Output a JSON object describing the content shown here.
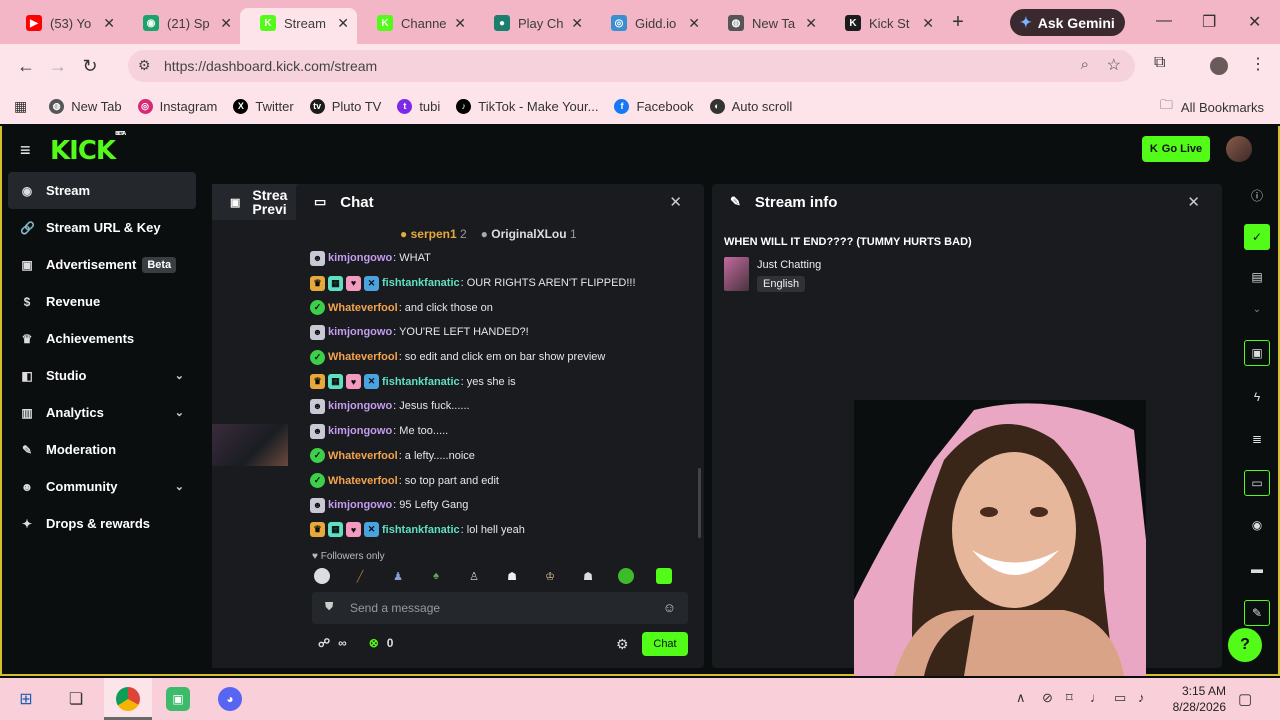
{
  "browser": {
    "tabs": [
      {
        "title": "(53) Yo",
        "favicon_color": "#ff0000",
        "favicon_glyph": "▶",
        "active": false
      },
      {
        "title": "(21) Sp",
        "favicon_color": "#1aa36a",
        "favicon_glyph": "◉",
        "active": false
      },
      {
        "title": "Stream",
        "favicon_color": "#53fc18",
        "favicon_glyph": "K",
        "active": true
      },
      {
        "title": "Channe",
        "favicon_color": "#53fc18",
        "favicon_glyph": "K",
        "active": false
      },
      {
        "title": "Play Ch",
        "favicon_color": "#1a7f6e",
        "favicon_glyph": "●",
        "active": false
      },
      {
        "title": "Gidd.io",
        "favicon_color": "#3a8fd0",
        "favicon_glyph": "◎",
        "active": false
      },
      {
        "title": "New Ta",
        "favicon_color": "#555555",
        "favicon_glyph": "◍",
        "active": false
      },
      {
        "title": "Kick St",
        "favicon_color": "#1c1c1c",
        "favicon_glyph": "K",
        "active": false
      }
    ],
    "gemini_label": "Ask Gemini",
    "url": "https://dashboard.kick.com/stream",
    "bookmarks": [
      {
        "label": "New Tab",
        "color": "#555555",
        "glyph": "◍"
      },
      {
        "label": "Instagram",
        "color": "#d62976",
        "glyph": "◎"
      },
      {
        "label": "Twitter",
        "color": "#000000",
        "glyph": "X"
      },
      {
        "label": "Pluto TV",
        "color": "#1c1c1c",
        "glyph": "tv"
      },
      {
        "label": "tubi",
        "color": "#7d2ae8",
        "glyph": "t"
      },
      {
        "label": "TikTok - Make Your...",
        "color": "#000000",
        "glyph": "♪"
      },
      {
        "label": "Facebook",
        "color": "#1877f2",
        "glyph": "f"
      },
      {
        "label": "Auto scroll",
        "color": "#333333",
        "glyph": "◐"
      }
    ],
    "all_bookmarks_label": "All Bookmarks"
  },
  "kick": {
    "logo": "KICK",
    "logo_sup": "BETA",
    "go_live_label": "Go Live",
    "accent": "#53fc18",
    "sidebar": [
      {
        "label": "Stream",
        "icon": "circle-dot-icon",
        "glyph": "◉",
        "active": true,
        "badge": "",
        "chevron": false
      },
      {
        "label": "Stream URL & Key",
        "icon": "link-icon",
        "glyph": "🔗",
        "active": false,
        "badge": "",
        "chevron": false
      },
      {
        "label": "Advertisement",
        "icon": "megaphone-icon",
        "glyph": "▣",
        "active": false,
        "badge": "Beta",
        "chevron": false
      },
      {
        "label": "Revenue",
        "icon": "money-icon",
        "glyph": "$",
        "active": false,
        "badge": "",
        "chevron": false
      },
      {
        "label": "Achievements",
        "icon": "trophy-icon",
        "glyph": "♛",
        "active": false,
        "badge": "",
        "chevron": false
      },
      {
        "label": "Studio",
        "icon": "studio-icon",
        "glyph": "◧",
        "active": false,
        "badge": "",
        "chevron": true
      },
      {
        "label": "Analytics",
        "icon": "chart-icon",
        "glyph": "▥",
        "active": false,
        "badge": "",
        "chevron": true
      },
      {
        "label": "Moderation",
        "icon": "wrench-icon",
        "glyph": "✎",
        "active": false,
        "badge": "",
        "chevron": false
      },
      {
        "label": "Community",
        "icon": "people-icon",
        "glyph": "☻",
        "active": false,
        "badge": "",
        "chevron": true
      },
      {
        "label": "Drops & rewards",
        "icon": "gift-icon",
        "glyph": "✦",
        "active": false,
        "badge": "",
        "chevron": false
      }
    ],
    "preview_title": "Strea Previ",
    "chat": {
      "title": "Chat",
      "pinned": [
        {
          "name": "serpen1",
          "count": "2"
        },
        {
          "name": "OriginalXLou",
          "count": "1"
        }
      ],
      "messages": [
        {
          "user": "kimjongowo",
          "text": ": WHAT",
          "type": "kim"
        },
        {
          "user": "fishtankfanatic",
          "text": ": OUR RIGHTS AREN'T FLIPPED!!!",
          "type": "fish"
        },
        {
          "user": "Whateverfool",
          "text": ": and click those on",
          "type": "what"
        },
        {
          "user": "kimjongowo",
          "text": ": YOU'RE LEFT HANDED?!",
          "type": "kim"
        },
        {
          "user": "Whateverfool",
          "text": ": so edit and click em on bar show preview",
          "type": "what"
        },
        {
          "user": "fishtankfanatic",
          "text": ": yes she is",
          "type": "fish"
        },
        {
          "user": "kimjongowo",
          "text": ": Jesus fuck......",
          "type": "kim"
        },
        {
          "user": "kimjongowo",
          "text": ": Me too.....",
          "type": "kim"
        },
        {
          "user": "Whateverfool",
          "text": ": a lefty.....noice",
          "type": "what"
        },
        {
          "user": "Whateverfool",
          "text": ": so top part and edit",
          "type": "what"
        },
        {
          "user": "kimjongowo",
          "text": ": 95 Lefty Gang",
          "type": "kim"
        },
        {
          "user": "fishtankfanatic",
          "text": ": lol hell yeah",
          "type": "fish"
        }
      ],
      "followers_only": "Followers only",
      "input_placeholder": "Send a message",
      "viewer_count": "∞",
      "points": "0",
      "send_label": "Chat"
    },
    "stream_info": {
      "title": "Stream info",
      "stream_title": "WHEN WILL IT END???? (TUMMY HURTS BAD)",
      "category": "Just Chatting",
      "language": "English"
    }
  },
  "taskbar": {
    "time": "3:15 AM",
    "date": "8/28/2026"
  }
}
